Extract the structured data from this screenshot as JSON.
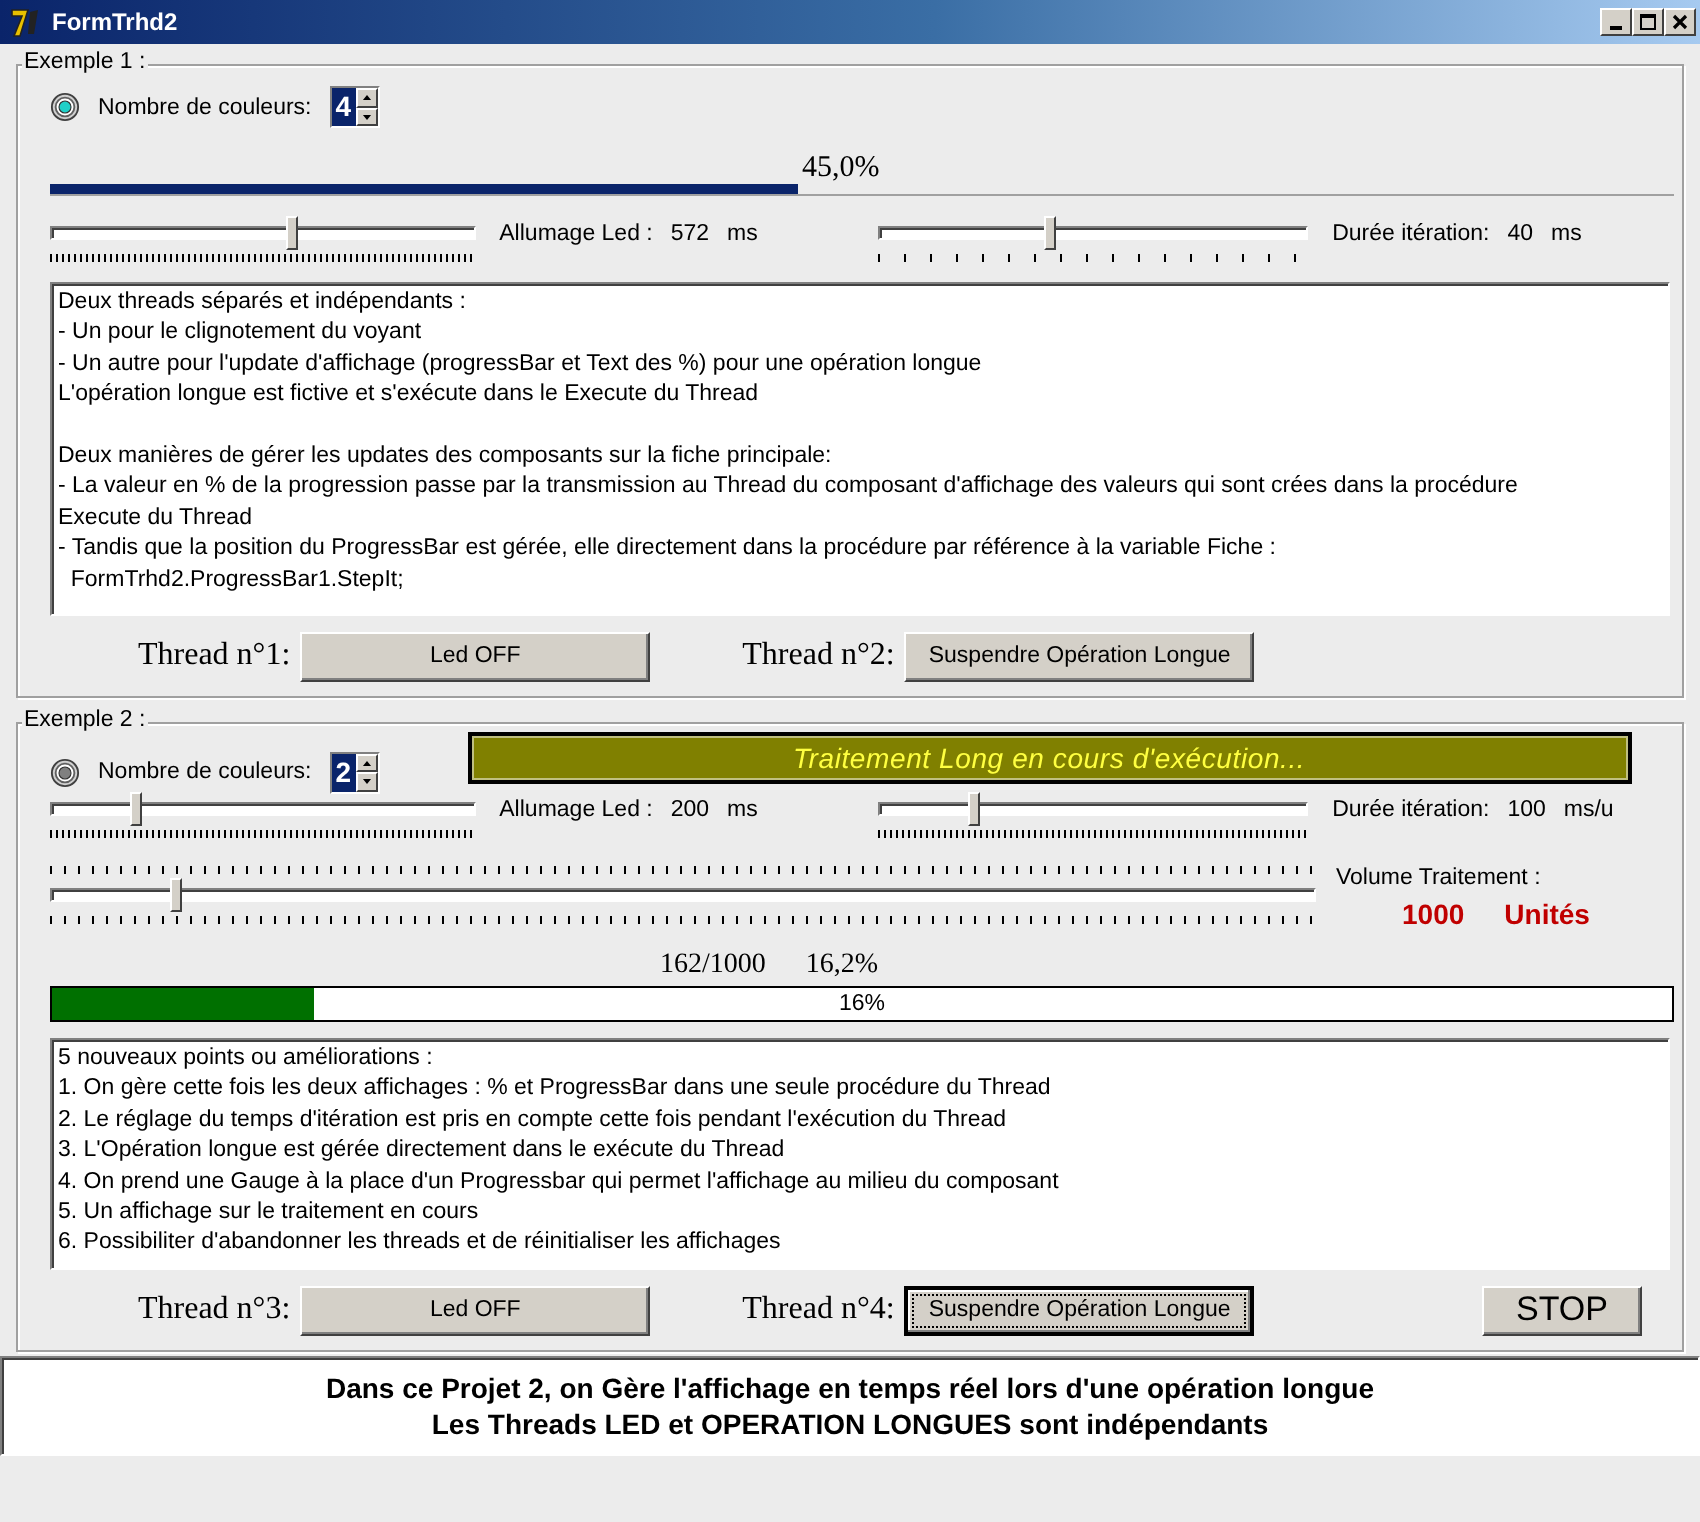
{
  "window": {
    "title": "FormTrhd2"
  },
  "example_1": {
    "title": "Exemple 1 :",
    "led": {
      "on": true
    },
    "colors": {
      "label": "Nombre de couleurs:",
      "value": "4"
    },
    "percent": "45,0%",
    "progress": {
      "level": 0.46
    },
    "led_slider": {
      "label": "Allumage Led :",
      "value": "572",
      "unit": "ms",
      "level": 0.57
    },
    "iteration_slider": {
      "label": "Durée itération:",
      "value": "40",
      "unit": "ms",
      "level": 0.4
    },
    "memo": [
      [
        "Deux threads séparés et indépendants :",
        "- Un pour le clignotement du voyant",
        "- Un autre pour l'update d'affichage (progressBar et Text des %) pour une opération longue",
        "L'opération longue est fictive et s'exécute dans le Execute du Thread"
      ],
      [
        "Deux manières de gérer les updates des composants sur la fiche principale:",
        "- La valeur en % de la progression passe par la transmission au Thread du composant d'affichage des valeurs qui sont crées dans la procédure",
        "Execute du Thread",
        "- Tandis que la position du ProgressBar est gérée, elle directement dans la procédure par référence à la variable Fiche :",
        "  FormTrhd2.ProgressBar1.StepIt;"
      ]
    ],
    "threads": [
      {
        "label": "Thread n°1:",
        "button": "Led OFF",
        "focused": false
      },
      {
        "label": "Thread n°2:",
        "button": "Suspendre Opération Longue",
        "focused": false
      }
    ]
  },
  "example_2": {
    "title": "Exemple 2 :",
    "led": {
      "on": false
    },
    "colors": {
      "label": "Nombre de couleurs:",
      "value": "2"
    },
    "banner": "Traitement Long en cours d'exécution...",
    "led_slider": {
      "label": "Allumage Led :",
      "value": "200",
      "unit": "ms",
      "level": 0.2
    },
    "iteration_slider": {
      "label": "Durée itération:",
      "value": "100",
      "unit": "ms/u",
      "level": 0.22
    },
    "volume_slider": {
      "level": 0.1
    },
    "volume": {
      "label": "Volume Traitement :",
      "value": "1000",
      "unit": "Unités"
    },
    "count": "162/1000",
    "percent": "16,2%",
    "gauge": {
      "level": 0.162,
      "text": "16%"
    },
    "memo": [
      [
        "5 nouveaux points ou améliorations :",
        "1. On gère cette fois les deux affichages : % et ProgressBar dans une seule procédure du Thread",
        "2. Le réglage du temps d'itération est pris en compte cette fois pendant l'exécution du Thread",
        "3. L'Opération longue est gérée directement dans le exécute du Thread",
        "4. On prend une Gauge à la place d'un Progressbar qui permet l'affichage au milieu du composant",
        "5. Un affichage sur le traitement en cours",
        "6. Possibiliter d'abandonner les threads et de réinitialiser les affichages"
      ]
    ],
    "threads": [
      {
        "label": "Thread n°3:",
        "button": "Led OFF",
        "focused": false
      },
      {
        "label": "Thread n°4:",
        "button": "Suspendre Opération Longue",
        "focused": true
      }
    ],
    "stop_button": "STOP"
  },
  "footer": {
    "lines": [
      "Dans ce Projet 2, on Gère l'affichage en temps réel lors d'une opération longue",
      "Les Threads LED et OPERATION LONGUES sont indépendants"
    ]
  }
}
